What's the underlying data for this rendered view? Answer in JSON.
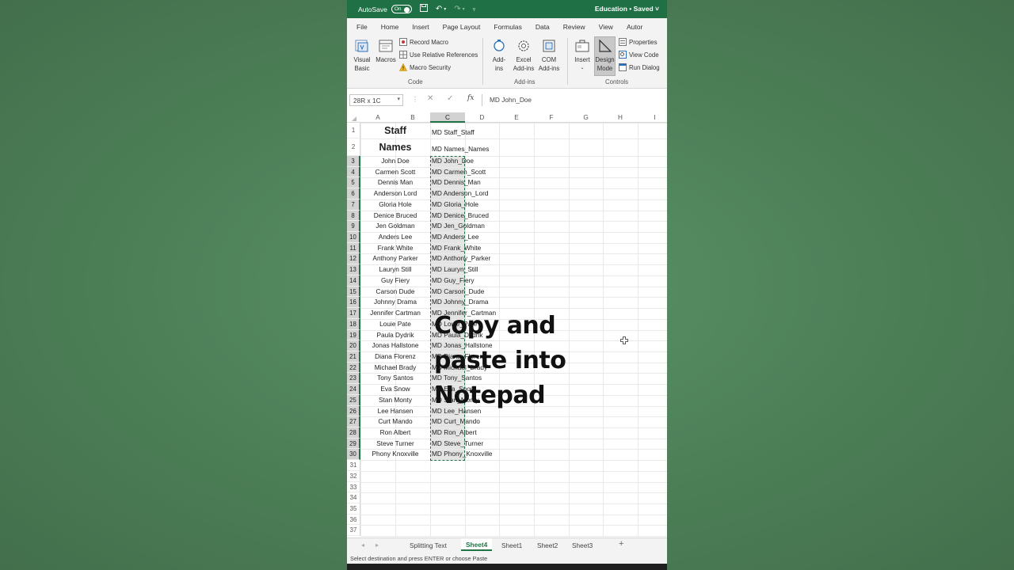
{
  "titlebar": {
    "autosave_label": "AutoSave",
    "autosave_state": "On",
    "doc_title": "Education • Saved ˅"
  },
  "ribbon": {
    "tabs": [
      "File",
      "Home",
      "Insert",
      "Page Layout",
      "Formulas",
      "Data",
      "Review",
      "View",
      "Autor"
    ],
    "code": {
      "visual_basic": "Visual\nBasic",
      "macros": "Macros",
      "record_macro": "Record Macro",
      "use_relative": "Use Relative References",
      "macro_security": "Macro Security",
      "label": "Code"
    },
    "addins": {
      "addins": "Add-\nins",
      "excel_addins": "Excel\nAdd-ins",
      "com_addins": "COM\nAdd-ins",
      "label": "Add-ins"
    },
    "controls": {
      "insert": "Insert",
      "design_mode": "Design\nMode",
      "properties": "Properties",
      "view_code": "View Code",
      "run_dialog": "Run Dialog",
      "label": "Controls"
    }
  },
  "formula_bar": {
    "name_box": "28R x 1C",
    "cancel_symbol": "✕",
    "enter_symbol": "✓",
    "fx_symbol": "fx",
    "value": "MD John_Doe"
  },
  "grid": {
    "columns": [
      "A",
      "B",
      "C",
      "D",
      "E",
      "F",
      "G",
      "H",
      "I"
    ],
    "header_row": {
      "staff": "Staff",
      "names": "Names",
      "c1": "MD Staff_Staff",
      "c2": "MD Names_Names"
    },
    "names": [
      "John Doe",
      "Carmen Scott",
      "Dennis Man",
      "Anderson Lord",
      "Gloria Hole",
      "Denice Bruced",
      "Jen Goldman",
      "Anders Lee",
      "Frank White",
      "Anthony Parker",
      "Lauryn Still",
      "Guy Fiery",
      "Carson Dude",
      "Johnny Drama",
      "Jennifer Cartman",
      "Louie Pate",
      "Paula Dydrik",
      "Jonas Hallstone",
      "Diana Florenz",
      "Michael Brady",
      "Tony Santos",
      "Eva Snow",
      "Stan Monty",
      "Lee Hansen",
      "Curt Mando",
      "Ron Albert",
      "Steve Turner",
      "Phony Knoxville"
    ],
    "formulas": [
      "MD John_Doe",
      "MD Carmen_Scott",
      "MD Dennis_Man",
      "MD Anderson_Lord",
      "MD Gloria_Hole",
      "MD Denice_Bruced",
      "MD Jen_Goldman",
      "MD Anders_Lee",
      "MD Frank_White",
      "MD Anthony_Parker",
      "MD Lauryn_Still",
      "MD Guy_Fiery",
      "MD Carson_Dude",
      "MD Johnny_Drama",
      "MD Jennifer_Cartman",
      "MD Louie_Pate",
      "MD Paula_Dydrik",
      "MD Jonas_Hallstone",
      "MD Diana_Florenz",
      "MD Michael_Brady",
      "MD Tony_Santos",
      "MD Eva_Snow",
      "MD Stan_Monty",
      "MD Lee_Hansen",
      "MD Curt_Mando",
      "MD Ron_Albert",
      "MD Steve_Turner",
      "MD Phony_Knoxville"
    ],
    "last_row": 37
  },
  "overlay": {
    "lines": [
      "Copy and",
      "paste into",
      "Notepad"
    ]
  },
  "sheets": {
    "tabs": [
      "Splitting Text",
      "Sheet4",
      "Sheet1",
      "Sheet2",
      "Sheet3"
    ],
    "active": "Sheet4",
    "add_symbol": "+"
  },
  "status": {
    "message": "Select destination and press ENTER or choose Paste"
  },
  "colors": {
    "excel_green": "#1f7145",
    "accent_green": "#217346",
    "background": "#4f8459"
  }
}
